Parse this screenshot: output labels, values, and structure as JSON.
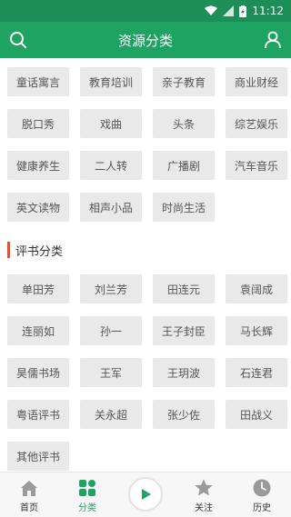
{
  "status_bar": {
    "time": "11:12"
  },
  "app_bar": {
    "title": "资源分类"
  },
  "categories": [
    "童话寓言",
    "教育培训",
    "亲子教育",
    "商业财经",
    "脱口秀",
    "戏曲",
    "头条",
    "综艺娱乐",
    "健康养生",
    "二人转",
    "广播剧",
    "汽车音乐",
    "英文读物",
    "相声小品",
    "时尚生活"
  ],
  "pingshu_section": {
    "title": "评书分类",
    "items": [
      "单田芳",
      "刘兰芳",
      "田连元",
      "袁阔成",
      "连丽如",
      "孙一",
      "王子封臣",
      "马长辉",
      "昊儒书场",
      "王军",
      "王玥波",
      "石连君",
      "粤语评书",
      "关永超",
      "张少佐",
      "田战义",
      "其他评书"
    ]
  },
  "bottom_nav": {
    "home": "首页",
    "category": "分类",
    "follow": "关注",
    "history": "历史"
  },
  "colors": {
    "primary": "#1fa362",
    "accent": "#e7502f"
  }
}
